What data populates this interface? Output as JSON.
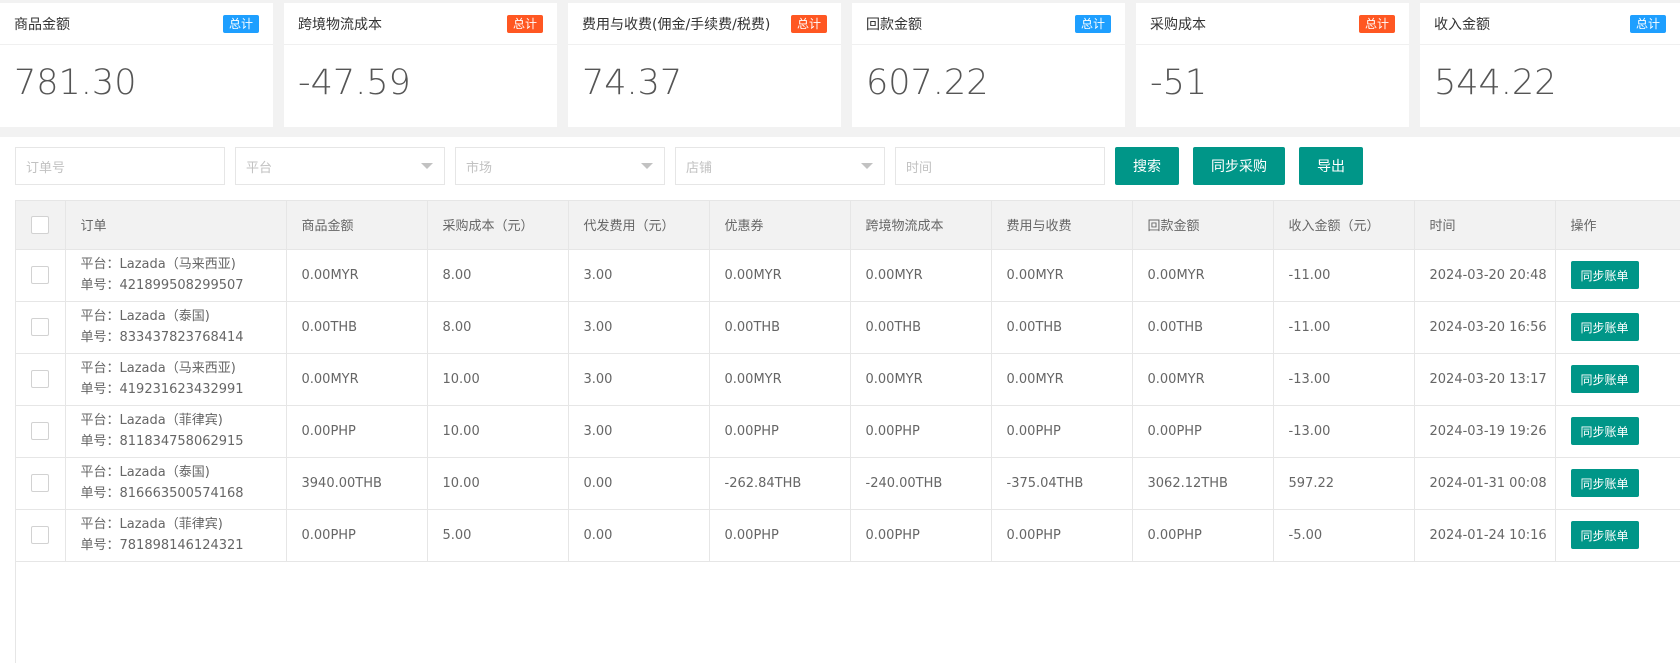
{
  "stats": [
    {
      "title": "商品金额",
      "badge": "总计",
      "badge_color": "#1e9fff",
      "value": "781.30"
    },
    {
      "title": "跨境物流成本",
      "badge": "总计",
      "badge_color": "#ff5722",
      "value": "-47.59"
    },
    {
      "title": "费用与收费(佣金/手续费/税费)",
      "badge": "总计",
      "badge_color": "#ff5722",
      "value": "74.37"
    },
    {
      "title": "回款金额",
      "badge": "总计",
      "badge_color": "#1e9fff",
      "value": "607.22"
    },
    {
      "title": "采购成本",
      "badge": "总计",
      "badge_color": "#ff5722",
      "value": "-51"
    },
    {
      "title": "收入金额",
      "badge": "总计",
      "badge_color": "#1e9fff",
      "value": "544.22"
    }
  ],
  "filters": {
    "order_no_placeholder": "订单号",
    "platform_placeholder": "平台",
    "market_placeholder": "市场",
    "shop_placeholder": "店铺",
    "time_placeholder": "时间",
    "search_label": "搜索",
    "sync_purchase_label": "同步采购",
    "export_label": "导出"
  },
  "table": {
    "headers": [
      "订单",
      "商品金额",
      "采购成本（元）",
      "代发费用（元）",
      "优惠券",
      "跨境物流成本",
      "费用与收费",
      "回款金额",
      "收入金额（元）",
      "时间",
      "操作"
    ],
    "action_label": "同步账单",
    "rows": [
      {
        "platform": "平台：Lazada（马来西亚)",
        "order": "单号：421899508299507",
        "goods": "0.00MYR",
        "purchase": "8.00",
        "dropship": "3.00",
        "coupon": "0.00MYR",
        "logistics": "0.00MYR",
        "fees": "0.00MYR",
        "refund": "0.00MYR",
        "income": "-11.00",
        "time": "2024-03-20 20:48"
      },
      {
        "platform": "平台：Lazada（泰国)",
        "order": "单号：833437823768414",
        "goods": "0.00THB",
        "purchase": "8.00",
        "dropship": "3.00",
        "coupon": "0.00THB",
        "logistics": "0.00THB",
        "fees": "0.00THB",
        "refund": "0.00THB",
        "income": "-11.00",
        "time": "2024-03-20 16:56"
      },
      {
        "platform": "平台：Lazada（马来西亚)",
        "order": "单号：419231623432991",
        "goods": "0.00MYR",
        "purchase": "10.00",
        "dropship": "3.00",
        "coupon": "0.00MYR",
        "logistics": "0.00MYR",
        "fees": "0.00MYR",
        "refund": "0.00MYR",
        "income": "-13.00",
        "time": "2024-03-20 13:17"
      },
      {
        "platform": "平台：Lazada（菲律宾)",
        "order": "单号：811834758062915",
        "goods": "0.00PHP",
        "purchase": "10.00",
        "dropship": "3.00",
        "coupon": "0.00PHP",
        "logistics": "0.00PHP",
        "fees": "0.00PHP",
        "refund": "0.00PHP",
        "income": "-13.00",
        "time": "2024-03-19 19:26"
      },
      {
        "platform": "平台：Lazada（泰国)",
        "order": "单号：816663500574168",
        "goods": "3940.00THB",
        "purchase": "10.00",
        "dropship": "0.00",
        "coupon": "-262.84THB",
        "logistics": "-240.00THB",
        "fees": "-375.04THB",
        "refund": "3062.12THB",
        "income": "597.22",
        "time": "2024-01-31 00:08"
      },
      {
        "platform": "平台：Lazada（菲律宾)",
        "order": "单号：781898146124321",
        "goods": "0.00PHP",
        "purchase": "5.00",
        "dropship": "0.00",
        "coupon": "0.00PHP",
        "logistics": "0.00PHP",
        "fees": "0.00PHP",
        "refund": "0.00PHP",
        "income": "-5.00",
        "time": "2024-01-24 10:16"
      }
    ]
  }
}
